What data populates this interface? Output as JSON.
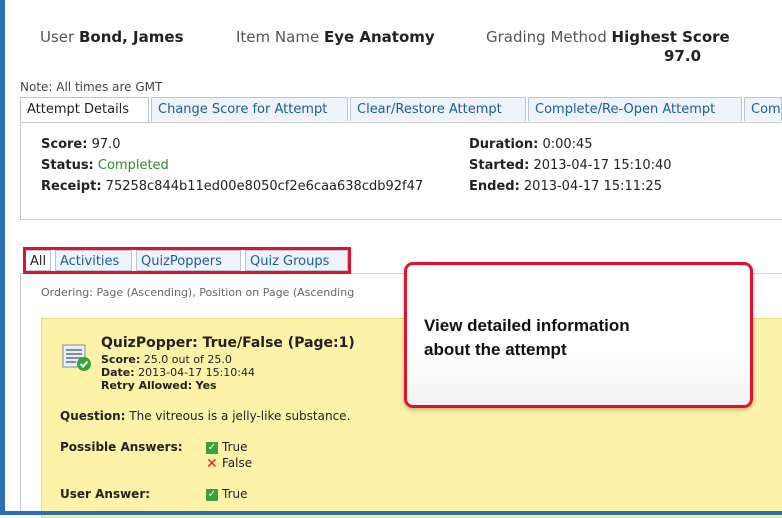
{
  "header": {
    "user_label": "User",
    "user_value": "Bond, James",
    "item_label": "Item Name",
    "item_value": "Eye Anatomy",
    "grading_label": "Grading Method",
    "grading_value": "Highest Score",
    "score_value": "97.0"
  },
  "note": "Note: All times are GMT",
  "tabs": [
    {
      "label": "Attempt Details",
      "active": true
    },
    {
      "label": "Change Score for Attempt",
      "active": false
    },
    {
      "label": "Clear/Restore Attempt",
      "active": false
    },
    {
      "label": "Complete/Re-Open Attempt",
      "active": false
    },
    {
      "label": "Com",
      "active": false
    }
  ],
  "details": {
    "score_label": "Score:",
    "score_value": "97.0",
    "status_label": "Status:",
    "status_value": "Completed",
    "receipt_label": "Receipt:",
    "receipt_value": "75258c844b11ed00e8050cf2e6caa638cdb92f47",
    "duration_label": "Duration:",
    "duration_value": "0:00:45",
    "started_label": "Started:",
    "started_value": "2013-04-17 15:10:40",
    "ended_label": "Ended:",
    "ended_value": "2013-04-17 15:11:25"
  },
  "subtabs": [
    {
      "label": "All",
      "active": true
    },
    {
      "label": "Activities",
      "active": false
    },
    {
      "label": "QuizPoppers",
      "active": false
    },
    {
      "label": "Quiz Groups",
      "active": false
    }
  ],
  "ordering": "Ordering: Page (Ascending), Position on Page (Ascending",
  "quiz": {
    "title": "QuizPopper: True/False (Page:1)",
    "score_label": "Score:",
    "score_value": "25.0 out of 25.0",
    "date_label": "Date:",
    "date_value": "2013-04-17 15:10:44",
    "retry_label": "Retry Allowed:",
    "retry_value": "Yes",
    "question_label": "Question:",
    "question_value": "The vitreous is a jelly-like substance.",
    "possible_label": "Possible Answers:",
    "answer_true": "True",
    "answer_false": "False",
    "user_answer_label": "User Answer:",
    "user_answer_value": "True"
  },
  "callout": {
    "line1": "View detailed information",
    "line2": "about the attempt"
  },
  "colors": {
    "accent_blue": "#1a5ca8",
    "highlight_red": "#e2122f",
    "completed_green": "#2e8b2e",
    "card_yellow": "#fdf2a8"
  }
}
